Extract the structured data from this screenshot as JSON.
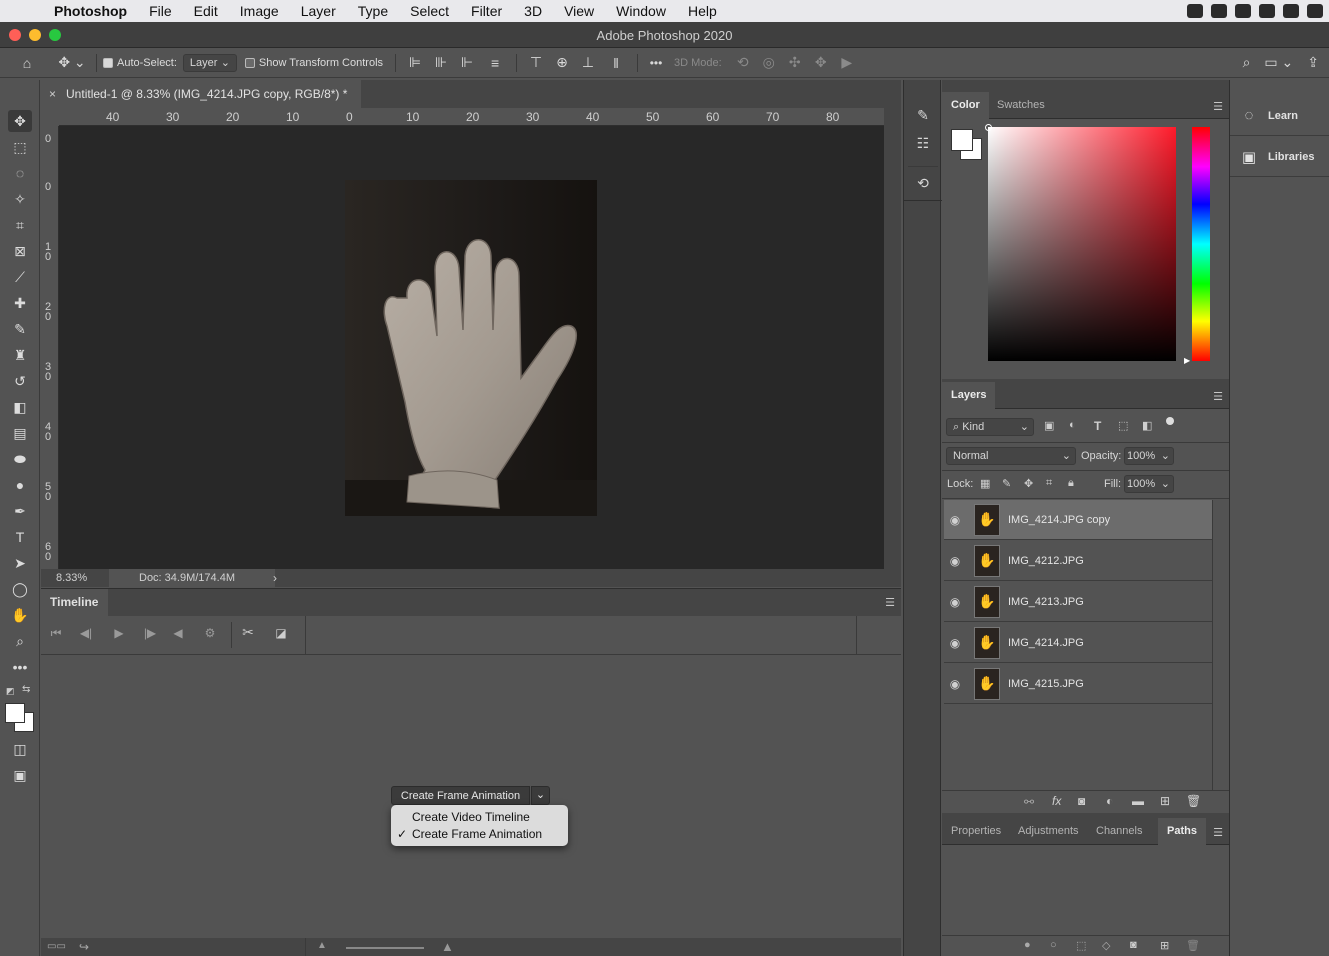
{
  "menubar": {
    "app": "Photoshop",
    "items": [
      "File",
      "Edit",
      "Image",
      "Layer",
      "Type",
      "Select",
      "Filter",
      "3D",
      "View",
      "Window",
      "Help"
    ]
  },
  "window": {
    "title": "Adobe Photoshop 2020"
  },
  "options": {
    "auto_select_label": "Auto-Select:",
    "auto_select_value": "Layer",
    "show_transform_label": "Show Transform Controls",
    "more": "•••",
    "mode3d_label": "3D Mode:"
  },
  "document": {
    "tab_close": "×",
    "tab_title": "Untitled-1 @ 8.33% (IMG_4214.JPG copy, RGB/8*) *",
    "ruler_top_labels": [
      "40",
      "30",
      "20",
      "10",
      "0",
      "10",
      "20",
      "30",
      "40",
      "50",
      "60",
      "70",
      "80"
    ],
    "ruler_left_labels": [
      "0",
      "0",
      "1\n0",
      "2\n0",
      "3\n0",
      "4\n0",
      "5\n0",
      "6\n0"
    ],
    "zoom": "8.33%",
    "doc_info": "Doc: 34.9M/174.4M",
    "status_arrow": "›"
  },
  "timeline": {
    "tab": "Timeline",
    "create_button": "Create Frame Animation",
    "dropdown_items": [
      "Create Video Timeline",
      "Create Frame Animation"
    ],
    "checked_item": "✓"
  },
  "color_panel": {
    "tabs": [
      "Color",
      "Swatches"
    ],
    "hue_color": "#ff1a2a"
  },
  "layers_panel": {
    "tab": "Layers",
    "kind_label": "Kind",
    "blend_mode": "Normal",
    "opacity_label": "Opacity:",
    "opacity_value": "100%",
    "lock_label": "Lock:",
    "fill_label": "Fill:",
    "fill_value": "100%",
    "layers": [
      {
        "name": "IMG_4214.JPG copy",
        "selected": true
      },
      {
        "name": "IMG_4212.JPG",
        "selected": false
      },
      {
        "name": "IMG_4213.JPG",
        "selected": false
      },
      {
        "name": "IMG_4214.JPG",
        "selected": false
      },
      {
        "name": "IMG_4215.JPG",
        "selected": false
      }
    ]
  },
  "bottom_panel": {
    "tabs": [
      "Properties",
      "Adjustments",
      "Channels",
      "Paths"
    ],
    "active_tab": "Paths"
  },
  "right_dock": {
    "items": [
      "Learn",
      "Libraries"
    ]
  }
}
